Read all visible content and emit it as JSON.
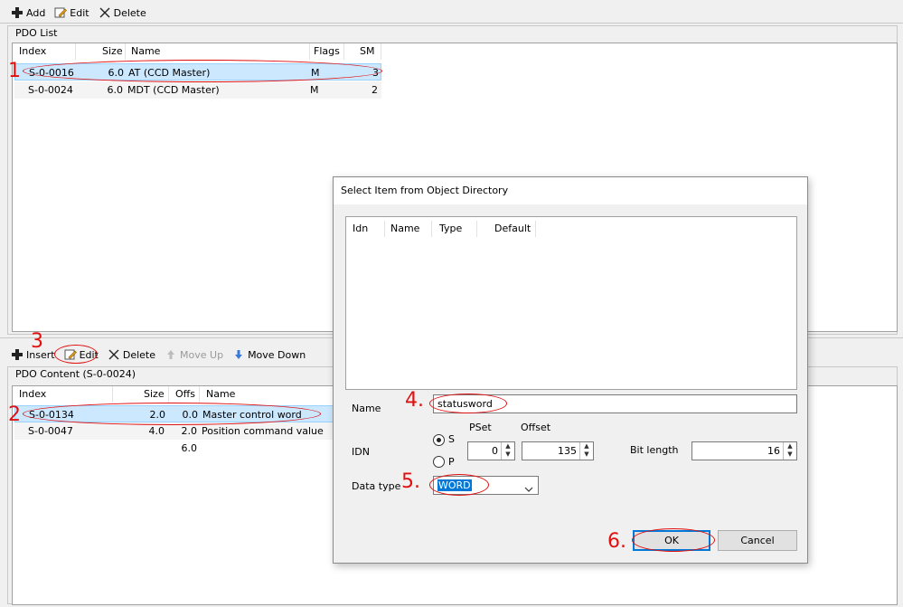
{
  "top_toolbar": {
    "add_label": "Add",
    "edit_label": "Edit",
    "delete_label": "Delete"
  },
  "pdo_list": {
    "title": "PDO List",
    "columns": [
      "Index",
      "Size",
      "Name",
      "Flags",
      "SM"
    ],
    "rows": [
      {
        "index": "S-0-0016",
        "size": "6.0",
        "name": "AT (CCD Master)",
        "flags": "M",
        "sm": "3"
      },
      {
        "index": "S-0-0024",
        "size": "6.0",
        "name": "MDT (CCD Master)",
        "flags": "M",
        "sm": "2"
      }
    ]
  },
  "bottom_toolbar": {
    "insert_label": "Insert",
    "edit_label": "Edit",
    "delete_label": "Delete",
    "move_up_label": "Move Up",
    "move_down_label": "Move Down"
  },
  "pdo_content": {
    "title": "PDO Content (S-0-0024)",
    "columns": [
      "Index",
      "Size",
      "Offs",
      "Name"
    ],
    "rows": [
      {
        "index": "S-0-0134",
        "size": "2.0",
        "offs": "0.0",
        "name": "Master control word"
      },
      {
        "index": "S-0-0047",
        "size": "4.0",
        "offs": "2.0",
        "name": "Position command value"
      },
      {
        "index": "",
        "size": "",
        "offs": "6.0",
        "name": ""
      }
    ]
  },
  "dialog": {
    "title": "Select Item from Object Directory",
    "columns": [
      "Idn",
      "Name",
      "Type",
      "Default"
    ],
    "name_label": "Name",
    "name_value": "statusword",
    "idn_label": "IDN",
    "radio_s": "S",
    "radio_p": "P",
    "pset_label": "PSet",
    "offset_label": "Offset",
    "pset_value": "0",
    "offset_value": "135",
    "bit_length_label": "Bit length",
    "bit_length_value": "16",
    "data_type_label": "Data type",
    "data_type_value": "WORD",
    "ok_label": "OK",
    "cancel_label": "Cancel"
  },
  "annotations": [
    "1",
    "2",
    "3",
    "4.",
    "5.",
    "6."
  ],
  "colors": {
    "selection": "#cce8ff",
    "annotation": "#e01010",
    "accent": "#0078d7"
  }
}
